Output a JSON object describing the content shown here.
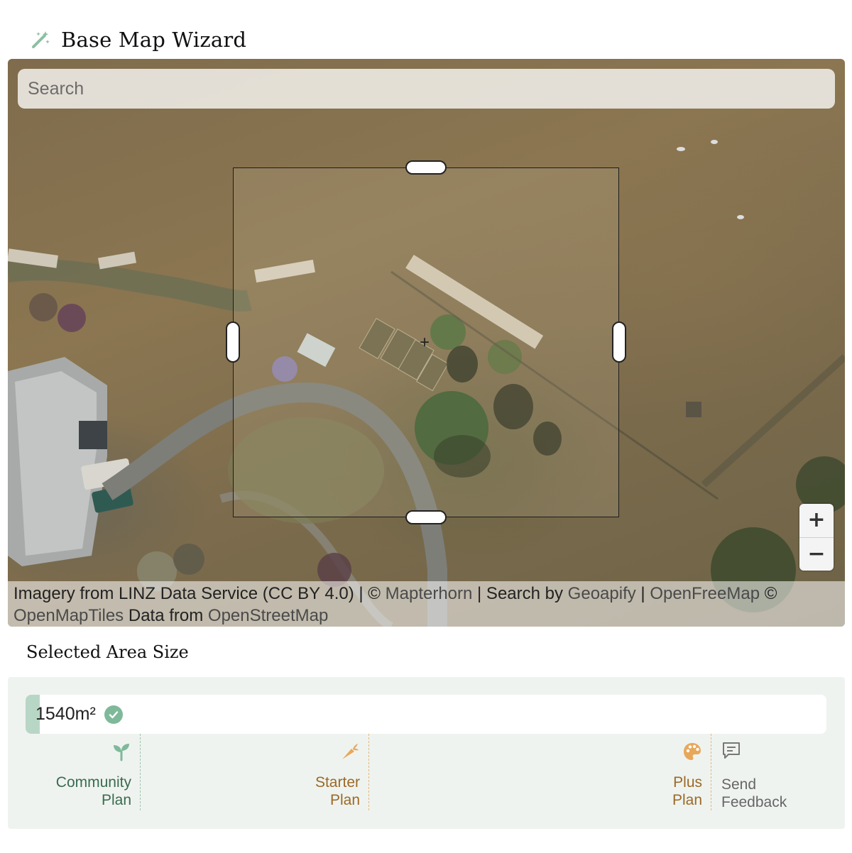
{
  "header": {
    "title": "Base Map Wizard",
    "icon": "magic-wand-icon"
  },
  "search": {
    "placeholder": "Search"
  },
  "map": {
    "zoom_in_label": "+",
    "zoom_out_label": "−",
    "attribution": {
      "imagery": "Imagery from LINZ Data Service (CC BY 4.0) | ©",
      "mapterhorn": "Mapterhorn",
      "search_by": "| Search by",
      "geoapify": "Geoapify",
      "sep": "|",
      "openfreemap": "OpenFreeMap",
      "copy": "©",
      "openmaptiles": "OpenMapTiles",
      "data_from": "Data from",
      "openstreetmap": "OpenStreetMap"
    }
  },
  "area": {
    "section_title": "Selected Area Size",
    "value": "1540m²",
    "fill_fraction": 0.018,
    "status_icon": "check-circle-icon"
  },
  "tiers": [
    {
      "name": "Community Plan",
      "line1": "Community",
      "line2": "Plan",
      "icon": "sprout-icon",
      "color": "#7fb99a"
    },
    {
      "name": "Starter Plan",
      "line1": "Starter",
      "line2": "Plan",
      "icon": "carrot-icon",
      "color": "#e8a85a"
    },
    {
      "name": "Plus Plan",
      "line1": "Plus",
      "line2": "Plan",
      "icon": "palette-icon",
      "color": "#e8a85a"
    }
  ],
  "feedback": {
    "line1": "Send",
    "line2": "Feedback",
    "icon": "message-icon"
  }
}
